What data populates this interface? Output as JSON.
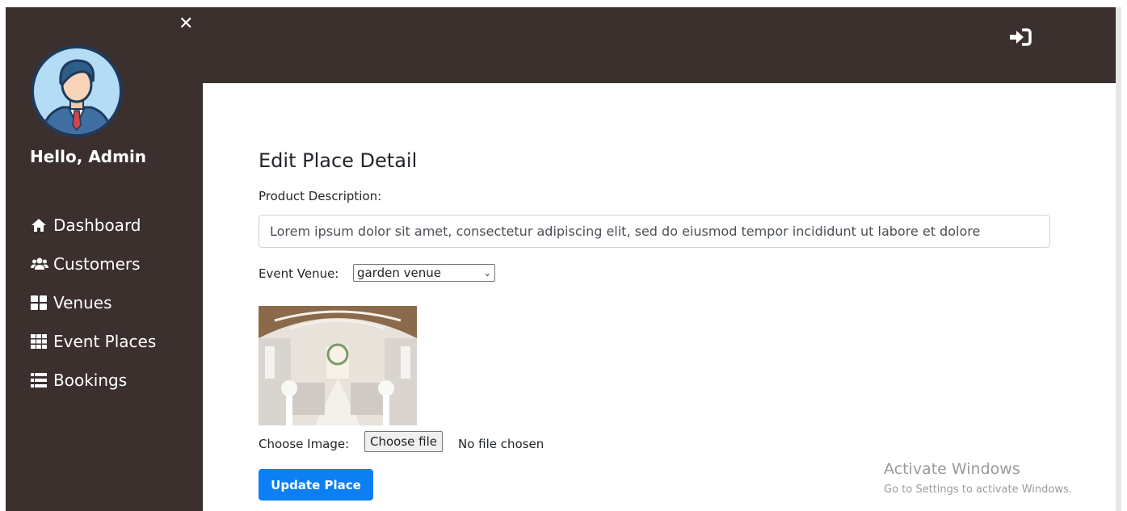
{
  "sidebar": {
    "close_icon": "close-icon",
    "greeting": "Hello, Admin",
    "items": [
      {
        "label": "Dashboard",
        "icon": "home-icon"
      },
      {
        "label": "Customers",
        "icon": "users-icon"
      },
      {
        "label": "Venues",
        "icon": "grid-icon"
      },
      {
        "label": "Event Places",
        "icon": "grid-3x3-icon"
      },
      {
        "label": "Bookings",
        "icon": "list-icon"
      }
    ]
  },
  "topbar": {
    "login_icon": "sign-in-icon"
  },
  "form": {
    "title": "Edit Place Detail",
    "description_label": "Product Description:",
    "description_value": "Lorem ipsum dolor sit amet, consectetur adipiscing elit, sed do eiusmod tempor incididunt ut labore et dolore",
    "venue_label": "Event Venue:",
    "venue_selected": "garden venue",
    "choose_image_label": "Choose Image:",
    "choose_file_button": "Choose file",
    "file_status": "No file chosen",
    "update_button": "Update Place"
  },
  "watermark": {
    "title": "Activate Windows",
    "subtitle": "Go to Settings to activate Windows."
  },
  "colors": {
    "sidebar_bg": "#3b302e",
    "primary_button": "#0d7ff5"
  }
}
